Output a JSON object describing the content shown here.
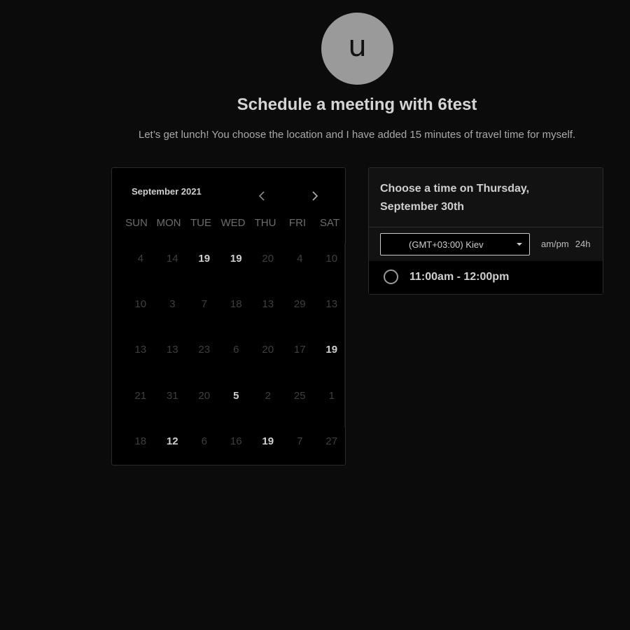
{
  "profile": {
    "avatar_initial": "u",
    "title": "Schedule a meeting with 6test",
    "description": "Let’s get lunch! You choose the location and I have added 15 minutes of travel time for myself."
  },
  "calendar": {
    "month_label": "September 2021",
    "prev_icon": "chevron-left-icon",
    "next_icon": "chevron-right-icon",
    "weekdays": [
      "SUN",
      "MON",
      "TUE",
      "WED",
      "THU",
      "FRI",
      "SAT"
    ],
    "rows": [
      [
        {
          "d": "4"
        },
        {
          "d": "14"
        },
        {
          "d": "19",
          "bright": true
        },
        {
          "d": "19",
          "bright": true
        },
        {
          "d": "20"
        },
        {
          "d": "4"
        },
        {
          "d": "10"
        }
      ],
      [
        {
          "d": "10"
        },
        {
          "d": "3"
        },
        {
          "d": "7"
        },
        {
          "d": "18"
        },
        {
          "d": "13"
        },
        {
          "d": "29"
        },
        {
          "d": "13"
        }
      ],
      [
        {
          "d": "13"
        },
        {
          "d": "13"
        },
        {
          "d": "23"
        },
        {
          "d": "6"
        },
        {
          "d": "20"
        },
        {
          "d": "17"
        },
        {
          "d": "19",
          "bright": true
        }
      ],
      [
        {
          "d": "21"
        },
        {
          "d": "31"
        },
        {
          "d": "20"
        },
        {
          "d": "5",
          "bright": true
        },
        {
          "d": "2"
        },
        {
          "d": "25"
        },
        {
          "d": "1"
        }
      ],
      [
        {
          "d": "18"
        },
        {
          "d": "12",
          "bright": true
        },
        {
          "d": "6"
        },
        {
          "d": "16"
        },
        {
          "d": "19",
          "bright": true
        },
        {
          "d": "7"
        },
        {
          "d": "27"
        }
      ]
    ]
  },
  "times": {
    "heading": "Choose a time on Thursday, September 30th",
    "timezone": "(GMT+03:00) Kiev",
    "format_ampm": "am/pm",
    "format_24h": "24h",
    "slots": [
      {
        "label": "11:00am - 12:00pm"
      }
    ]
  },
  "colors": {
    "background": "#0b0b0b",
    "avatar": "#9a9a9a",
    "text_primary": "#d4d4d4",
    "text_muted": "#3f3f3f"
  }
}
